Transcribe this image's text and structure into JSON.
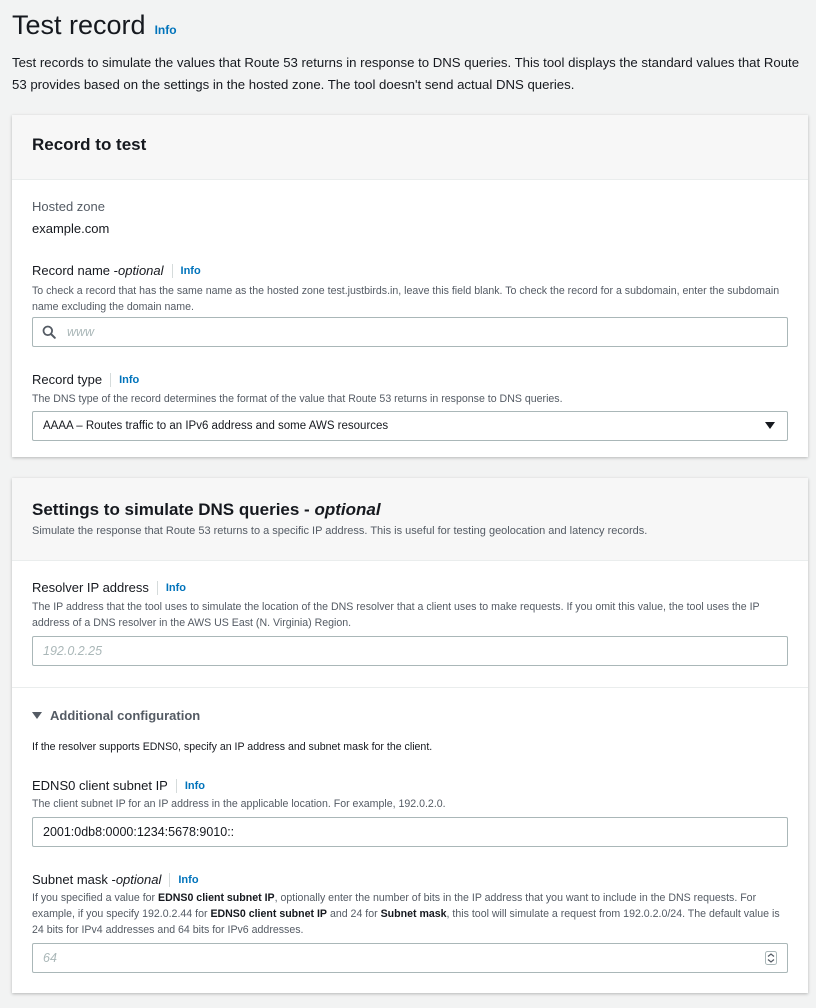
{
  "page": {
    "title": "Test record",
    "title_info": "Info",
    "description": "Test records to simulate the values that Route 53 returns in response to DNS queries. This tool displays the standard values that Route 53 provides based on the settings in the hosted zone. The tool doesn't send actual DNS queries."
  },
  "record_panel": {
    "title": "Record to test",
    "hosted_zone_label": "Hosted zone",
    "hosted_zone_value": "example.com",
    "record_name": {
      "label": "Record name - ",
      "label_optional": "optional",
      "info": "Info",
      "hint": "To check a record that has the same name as the hosted zone test.justbirds.in, leave this field blank. To check the record for a subdomain, enter the subdomain name excluding the domain name.",
      "placeholder": "www"
    },
    "record_type": {
      "label": "Record type",
      "info": "Info",
      "hint": "The DNS type of the record determines the format of the value that Route 53 returns in response to DNS queries.",
      "selected": "AAAA – Routes traffic to an IPv6 address and some AWS resources"
    }
  },
  "settings_panel": {
    "title": "Settings to simulate DNS queries - ",
    "title_optional": "optional",
    "subtitle": "Simulate the response that Route 53 returns to a specific IP address. This is useful for testing geolocation and latency records.",
    "resolver": {
      "label": "Resolver IP address",
      "info": "Info",
      "hint": "The IP address that the tool uses to simulate the location of the DNS resolver that a client uses to make requests. If you omit this value, the tool uses the IP address of a DNS resolver in the AWS US East (N. Virginia) Region.",
      "placeholder": "192.0.2.25"
    },
    "additional": {
      "label": "Additional configuration",
      "description": "If the resolver supports EDNS0, specify an IP address and subnet mask for the client."
    },
    "edns": {
      "label": "EDNS0 client subnet IP",
      "info": "Info",
      "hint": "The client subnet IP for an IP address in the applicable location. For example, 192.0.2.0.",
      "value": "2001:0db8:0000:1234:5678:9010::"
    },
    "subnet": {
      "label": "Subnet mask - ",
      "label_optional": "optional",
      "info": "Info",
      "hint_part1": "If you specified a value for ",
      "hint_bold1": "EDNS0 client subnet IP",
      "hint_part2": ", optionally enter the number of bits in the IP address that you want to include in the DNS requests. For example, if you specify 192.0.2.44 for ",
      "hint_bold2": "EDNS0 client subnet IP",
      "hint_part3": " and 24 for ",
      "hint_bold3": "Subnet mask",
      "hint_part4": ", this tool will simulate a request from 192.0.2.0/24. The default value is 24 bits for IPv4 addresses and 64 bits for IPv6 addresses.",
      "placeholder": "64"
    }
  },
  "icons": {
    "search": "search-icon",
    "dropdown": "caret-down-icon",
    "expand": "caret-down-icon",
    "stepper": "stepper-icon"
  },
  "colors": {
    "info_link": "#0073bb",
    "background": "#f2f3f3"
  }
}
